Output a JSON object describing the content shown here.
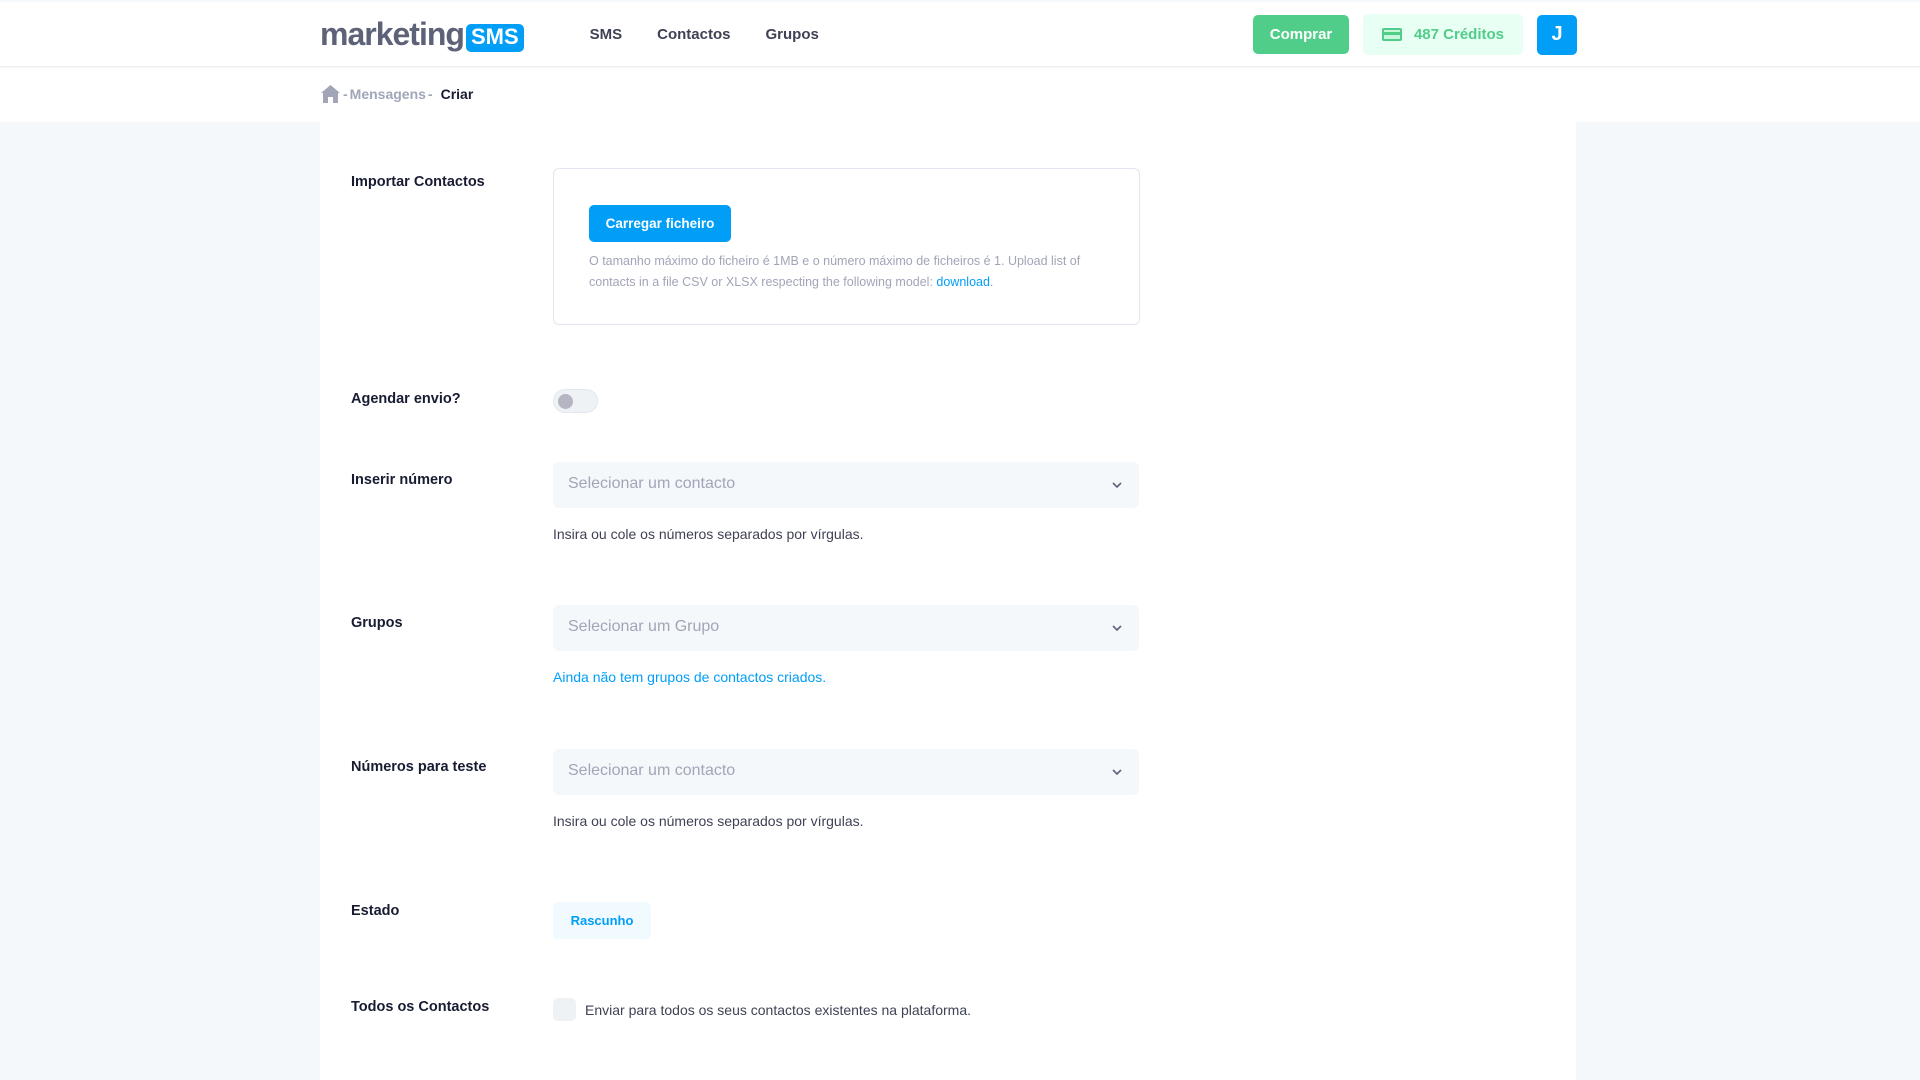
{
  "brand": {
    "word": "marketing",
    "badge": "SMS"
  },
  "nav": [
    {
      "label": "SMS"
    },
    {
      "label": "Contactos"
    },
    {
      "label": "Grupos"
    }
  ],
  "header": {
    "buy_label": "Comprar",
    "credits_label": "487 Créditos",
    "avatar_initial": "J"
  },
  "breadcrumb": {
    "sep": "-",
    "items": [
      "Mensagens",
      "Criar"
    ]
  },
  "form": {
    "import": {
      "label": "Importar Contactos",
      "button": "Carregar ficheiro",
      "help": "O tamanho máximo do ficheiro é 1MB e o número máximo de ficheiros é 1. Upload list of contacts in a file CSV or XLSX respecting the following model: ",
      "link": "download",
      "after_link": "."
    },
    "schedule": {
      "label": "Agendar envio?",
      "enabled": false
    },
    "number": {
      "label": "Inserir número",
      "placeholder": "Selecionar um contacto",
      "help": "Insira ou cole os números separados por vírgulas."
    },
    "groups": {
      "label": "Grupos",
      "placeholder": "Selecionar um Grupo",
      "help": "Ainda não tem grupos de contactos criados."
    },
    "test_numbers": {
      "label": "Números para teste",
      "placeholder": "Selecionar um contacto",
      "help": "Insira ou cole os números separados por vírgulas."
    },
    "status": {
      "label": "Estado",
      "value": "Rascunho"
    },
    "all_contacts": {
      "label": "Todos os Contactos",
      "checkbox_text": "Enviar para todos os seus contactos existentes na plataforma.",
      "checked": false
    }
  },
  "colors": {
    "primary": "#009ef7",
    "success": "#50cd89",
    "success_light": "#e8fff3",
    "muted": "#a1a5b7"
  }
}
